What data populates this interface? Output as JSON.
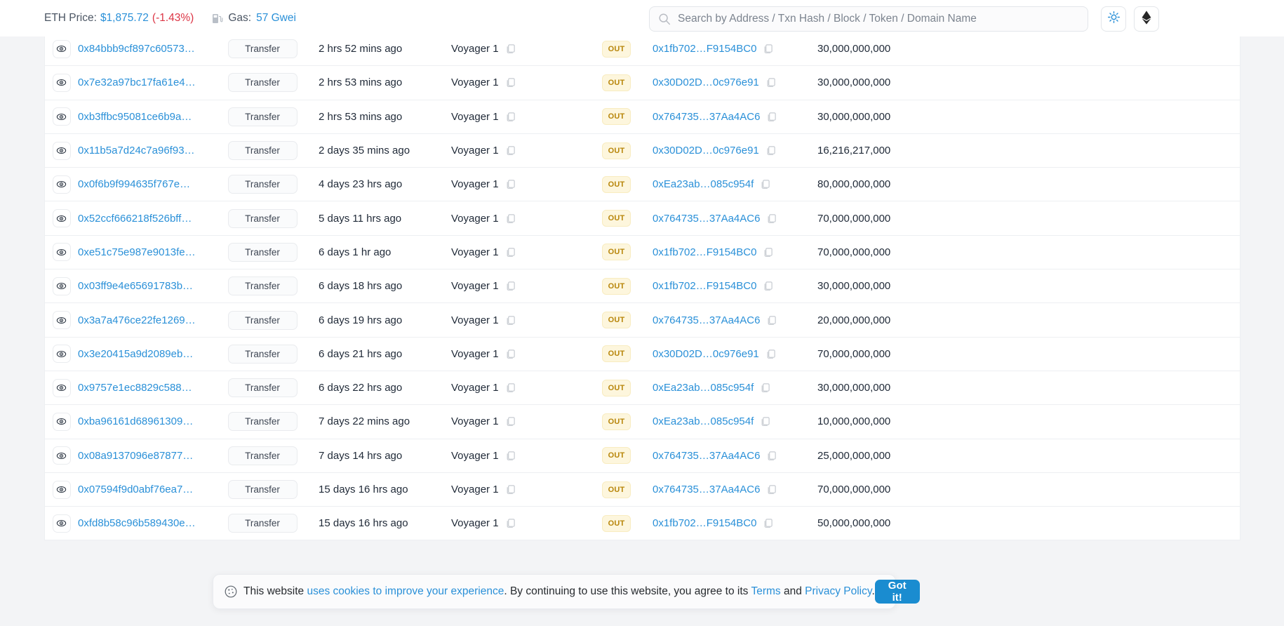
{
  "header": {
    "eth_price_label": "ETH Price:",
    "eth_price_value": "$1,875.72",
    "eth_price_change": "(-1.43%)",
    "gas_label": "Gas:",
    "gas_value": "57 Gwei",
    "search_placeholder": "Search by Address / Txn Hash / Block / Token / Domain Name",
    "search_value": "",
    "theme_icon": "sun-icon",
    "chain_icon": "ethereum-diamond-icon"
  },
  "colors": {
    "link": "#2a90d8",
    "negative": "#dc3545",
    "badge_out_bg": "#fdf6dd",
    "badge_out_text": "#b8860b",
    "primary_button": "#1a8cd0"
  },
  "table": {
    "rows": [
      {
        "hash": "0x84bbb9cf897c60573…",
        "method": "Transfer",
        "age": "2 hrs 52 mins ago",
        "from": "Voyager 1",
        "dir": "OUT",
        "to": "0x1fb702…F9154BC0",
        "amount": "30,000,000,000"
      },
      {
        "hash": "0x7e32a97bc17fa61e4…",
        "method": "Transfer",
        "age": "2 hrs 53 mins ago",
        "from": "Voyager 1",
        "dir": "OUT",
        "to": "0x30D02D…0c976e91",
        "amount": "30,000,000,000"
      },
      {
        "hash": "0xb3ffbc95081ce6b9a…",
        "method": "Transfer",
        "age": "2 hrs 53 mins ago",
        "from": "Voyager 1",
        "dir": "OUT",
        "to": "0x764735…37Aa4AC6",
        "amount": "30,000,000,000"
      },
      {
        "hash": "0x11b5a7d24c7a96f93…",
        "method": "Transfer",
        "age": "2 days 35 mins ago",
        "from": "Voyager 1",
        "dir": "OUT",
        "to": "0x30D02D…0c976e91",
        "amount": "16,216,217,000"
      },
      {
        "hash": "0x0f6b9f994635f767e…",
        "method": "Transfer",
        "age": "4 days 23 hrs ago",
        "from": "Voyager 1",
        "dir": "OUT",
        "to": "0xEa23ab…085c954f",
        "amount": "80,000,000,000"
      },
      {
        "hash": "0x52ccf666218f526bff…",
        "method": "Transfer",
        "age": "5 days 11 hrs ago",
        "from": "Voyager 1",
        "dir": "OUT",
        "to": "0x764735…37Aa4AC6",
        "amount": "70,000,000,000"
      },
      {
        "hash": "0xe51c75e987e9013fe…",
        "method": "Transfer",
        "age": "6 days 1 hr ago",
        "from": "Voyager 1",
        "dir": "OUT",
        "to": "0x1fb702…F9154BC0",
        "amount": "70,000,000,000"
      },
      {
        "hash": "0x03ff9e4e65691783b…",
        "method": "Transfer",
        "age": "6 days 18 hrs ago",
        "from": "Voyager 1",
        "dir": "OUT",
        "to": "0x1fb702…F9154BC0",
        "amount": "30,000,000,000"
      },
      {
        "hash": "0x3a7a476ce22fe1269…",
        "method": "Transfer",
        "age": "6 days 19 hrs ago",
        "from": "Voyager 1",
        "dir": "OUT",
        "to": "0x764735…37Aa4AC6",
        "amount": "20,000,000,000"
      },
      {
        "hash": "0x3e20415a9d2089eb…",
        "method": "Transfer",
        "age": "6 days 21 hrs ago",
        "from": "Voyager 1",
        "dir": "OUT",
        "to": "0x30D02D…0c976e91",
        "amount": "70,000,000,000"
      },
      {
        "hash": "0x9757e1ec8829c588…",
        "method": "Transfer",
        "age": "6 days 22 hrs ago",
        "from": "Voyager 1",
        "dir": "OUT",
        "to": "0xEa23ab…085c954f",
        "amount": "30,000,000,000"
      },
      {
        "hash": "0xba96161d68961309…",
        "method": "Transfer",
        "age": "7 days 22 mins ago",
        "from": "Voyager 1",
        "dir": "OUT",
        "to": "0xEa23ab…085c954f",
        "amount": "10,000,000,000"
      },
      {
        "hash": "0x08a9137096e87877…",
        "method": "Transfer",
        "age": "7 days 14 hrs ago",
        "from": "Voyager 1",
        "dir": "OUT",
        "to": "0x764735…37Aa4AC6",
        "amount": "25,000,000,000"
      },
      {
        "hash": "0x07594f9d0abf76ea7…",
        "method": "Transfer",
        "age": "15 days 16 hrs ago",
        "from": "Voyager 1",
        "dir": "OUT",
        "to": "0x764735…37Aa4AC6",
        "amount": "70,000,000,000"
      },
      {
        "hash": "0xfd8b58c96b589430e…",
        "method": "Transfer",
        "age": "15 days 16 hrs ago",
        "from": "Voyager 1",
        "dir": "OUT",
        "to": "0x1fb702…F9154BC0",
        "amount": "50,000,000,000"
      }
    ]
  },
  "cookie_banner": {
    "icon": "cookie-icon",
    "text_1": "This website ",
    "link_1": "uses cookies to improve your experience",
    "text_2": ". By continuing to use this website, you agree to its ",
    "link_2": "Terms",
    "text_3": " and ",
    "link_3": "Privacy Policy",
    "text_4": ".",
    "accept_label": "Got it!"
  }
}
